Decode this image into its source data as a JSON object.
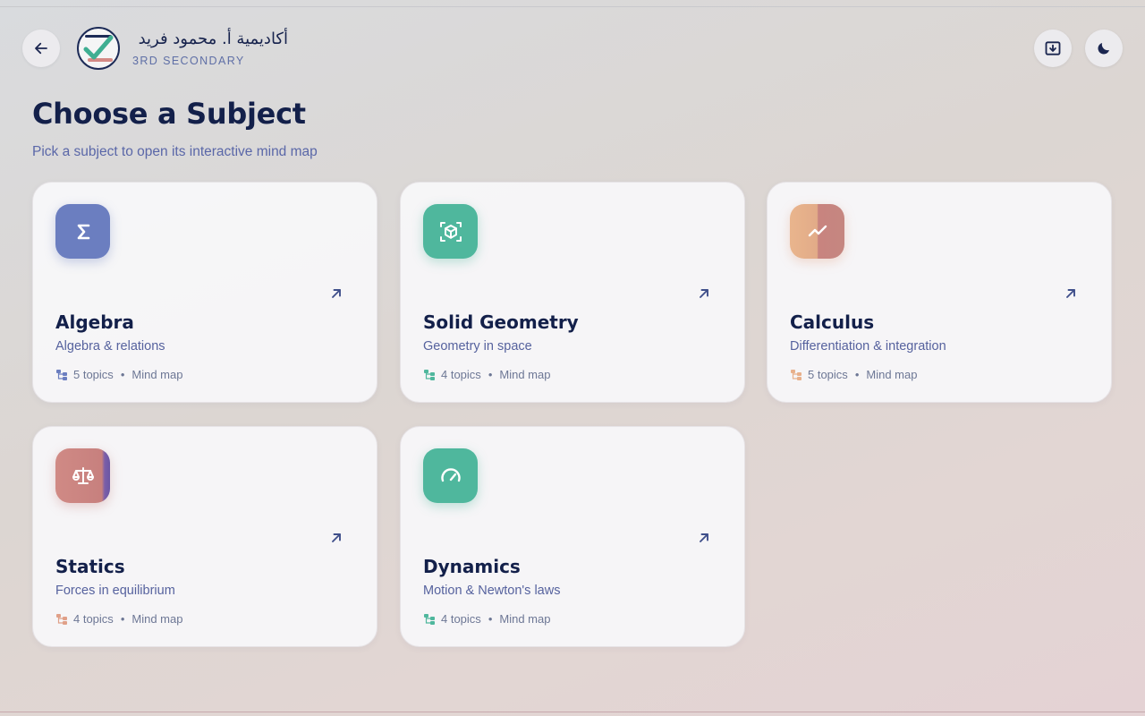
{
  "header": {
    "brand_name": "أكاديمية أ. محمود فريد",
    "brand_subtitle": "3RD SECONDARY"
  },
  "page": {
    "title": "Choose a Subject",
    "subtitle": "Pick a subject to open its interactive mind map"
  },
  "subjects": [
    {
      "title": "Algebra",
      "description": "Algebra & relations",
      "topics": "5 topics",
      "meta": "Mind map",
      "icon": "sigma-icon",
      "color": "#6b7ec0"
    },
    {
      "title": "Solid Geometry",
      "description": "Geometry in space",
      "topics": "4 topics",
      "meta": "Mind map",
      "icon": "cube-icon",
      "color": "#4fb79d"
    },
    {
      "title": "Calculus",
      "description": "Differentiation & integration",
      "topics": "5 topics",
      "meta": "Mind map",
      "icon": "trend-icon",
      "color": "#e8b08b"
    },
    {
      "title": "Statics",
      "description": "Forces in equilibrium",
      "topics": "4 topics",
      "meta": "Mind map",
      "icon": "scale-icon",
      "color": "#c98581"
    },
    {
      "title": "Dynamics",
      "description": "Motion & Newton's laws",
      "topics": "4 topics",
      "meta": "Mind map",
      "icon": "gauge-icon",
      "color": "#4fb79d"
    }
  ],
  "colors": {
    "title": "#13204a",
    "accent": "#5a67a8",
    "card": "#f8f8fa"
  }
}
